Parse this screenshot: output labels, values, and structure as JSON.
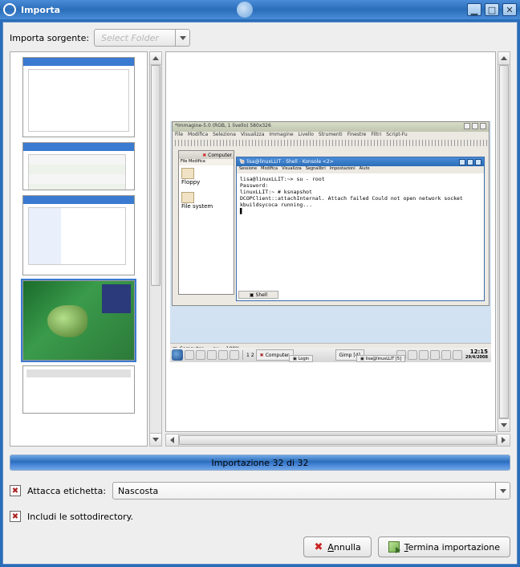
{
  "window": {
    "title": "Importa",
    "buttons": {
      "min": "▁",
      "max": "□",
      "close": "✕"
    }
  },
  "source": {
    "label": "Importa sorgente:",
    "placeholder": "Select Folder"
  },
  "preview": {
    "gimp_title": "*Immagine-5.0 (RGB, 1 livello) 580x326",
    "gimp_menu": [
      "File",
      "Modifica",
      "Seleziona",
      "Visualizza",
      "Immagine",
      "Livello",
      "Strumenti",
      "Finestre",
      "Filtri",
      "Script-Fu"
    ],
    "konq_title": "Computer",
    "konq_menu": "File  Modifica",
    "konq_items": [
      "Floppy",
      "File system"
    ],
    "term_title": "lisa@linuxLLIT - Shell - Konsole <2>",
    "term_menu": [
      "Sessione",
      "Modifica",
      "Visualizza",
      "Segnalibri",
      "Impostazioni",
      "Aiuto"
    ],
    "term_lines": "lisa@linuxLLIT:~> su - root\nPassword:\nlinuxLLIT:~ # ksnapshot\nDCOPClient::attachInternal. Attach failed Could not open network socket\nkbuildsycoca running...\n▋",
    "term_tab": "Shell",
    "status_left": "Computer ▾",
    "status_px": "px",
    "status_zoom": "100%",
    "task1": "Computer",
    "task1_sub": "Login",
    "task2": "Gimp [4]",
    "task2_sub": "lisa@linuxLLIT [5]",
    "clock_time": "12:15",
    "clock_date": "29/4/2008"
  },
  "progress": {
    "text": "Importazione 32 di 32"
  },
  "attach": {
    "label": "Attacca etichetta:",
    "value": "Nascosta"
  },
  "subdirs": {
    "label": "Includi le sottodirectory."
  },
  "buttons": {
    "cancel_u": "A",
    "cancel_rest": "nnulla",
    "finish_u": "T",
    "finish_rest": "ermina importazione"
  }
}
